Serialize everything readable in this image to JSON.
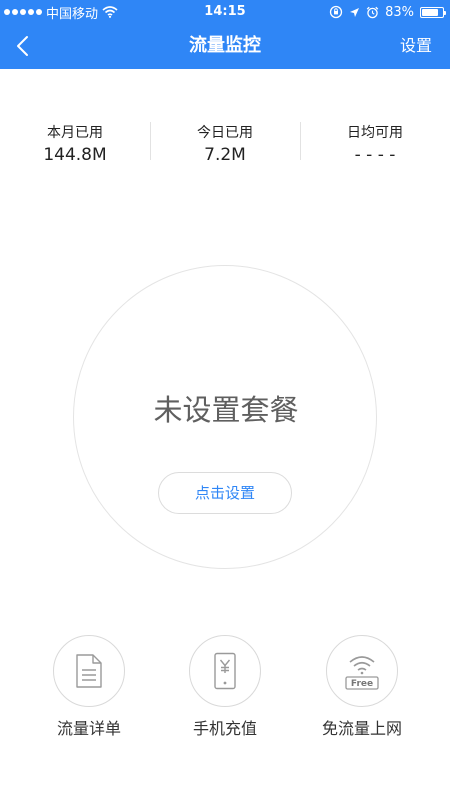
{
  "status_bar": {
    "carrier": "中国移动",
    "time": "14:15",
    "battery": "83%",
    "battery_level": 0.83
  },
  "nav": {
    "title": "流量监控",
    "settings_label": "设置"
  },
  "stats": [
    {
      "label": "本月已用",
      "value": "144.8M"
    },
    {
      "label": "今日已用",
      "value": "7.2M"
    },
    {
      "label": "日均可用",
      "value": "- - - -"
    }
  ],
  "plan": {
    "status": "未设置套餐",
    "setup_label": "点击设置"
  },
  "actions": [
    {
      "label": "流量详单",
      "icon": "document-icon"
    },
    {
      "label": "手机充值",
      "icon": "phone-yuan-icon"
    },
    {
      "label": "免流量上网",
      "icon": "free-wifi-icon",
      "badge": "Free"
    }
  ],
  "colors": {
    "accent": "#2f86f6",
    "text": "#222222",
    "muted": "#5f5f5f",
    "border": "#d9d9d9"
  }
}
